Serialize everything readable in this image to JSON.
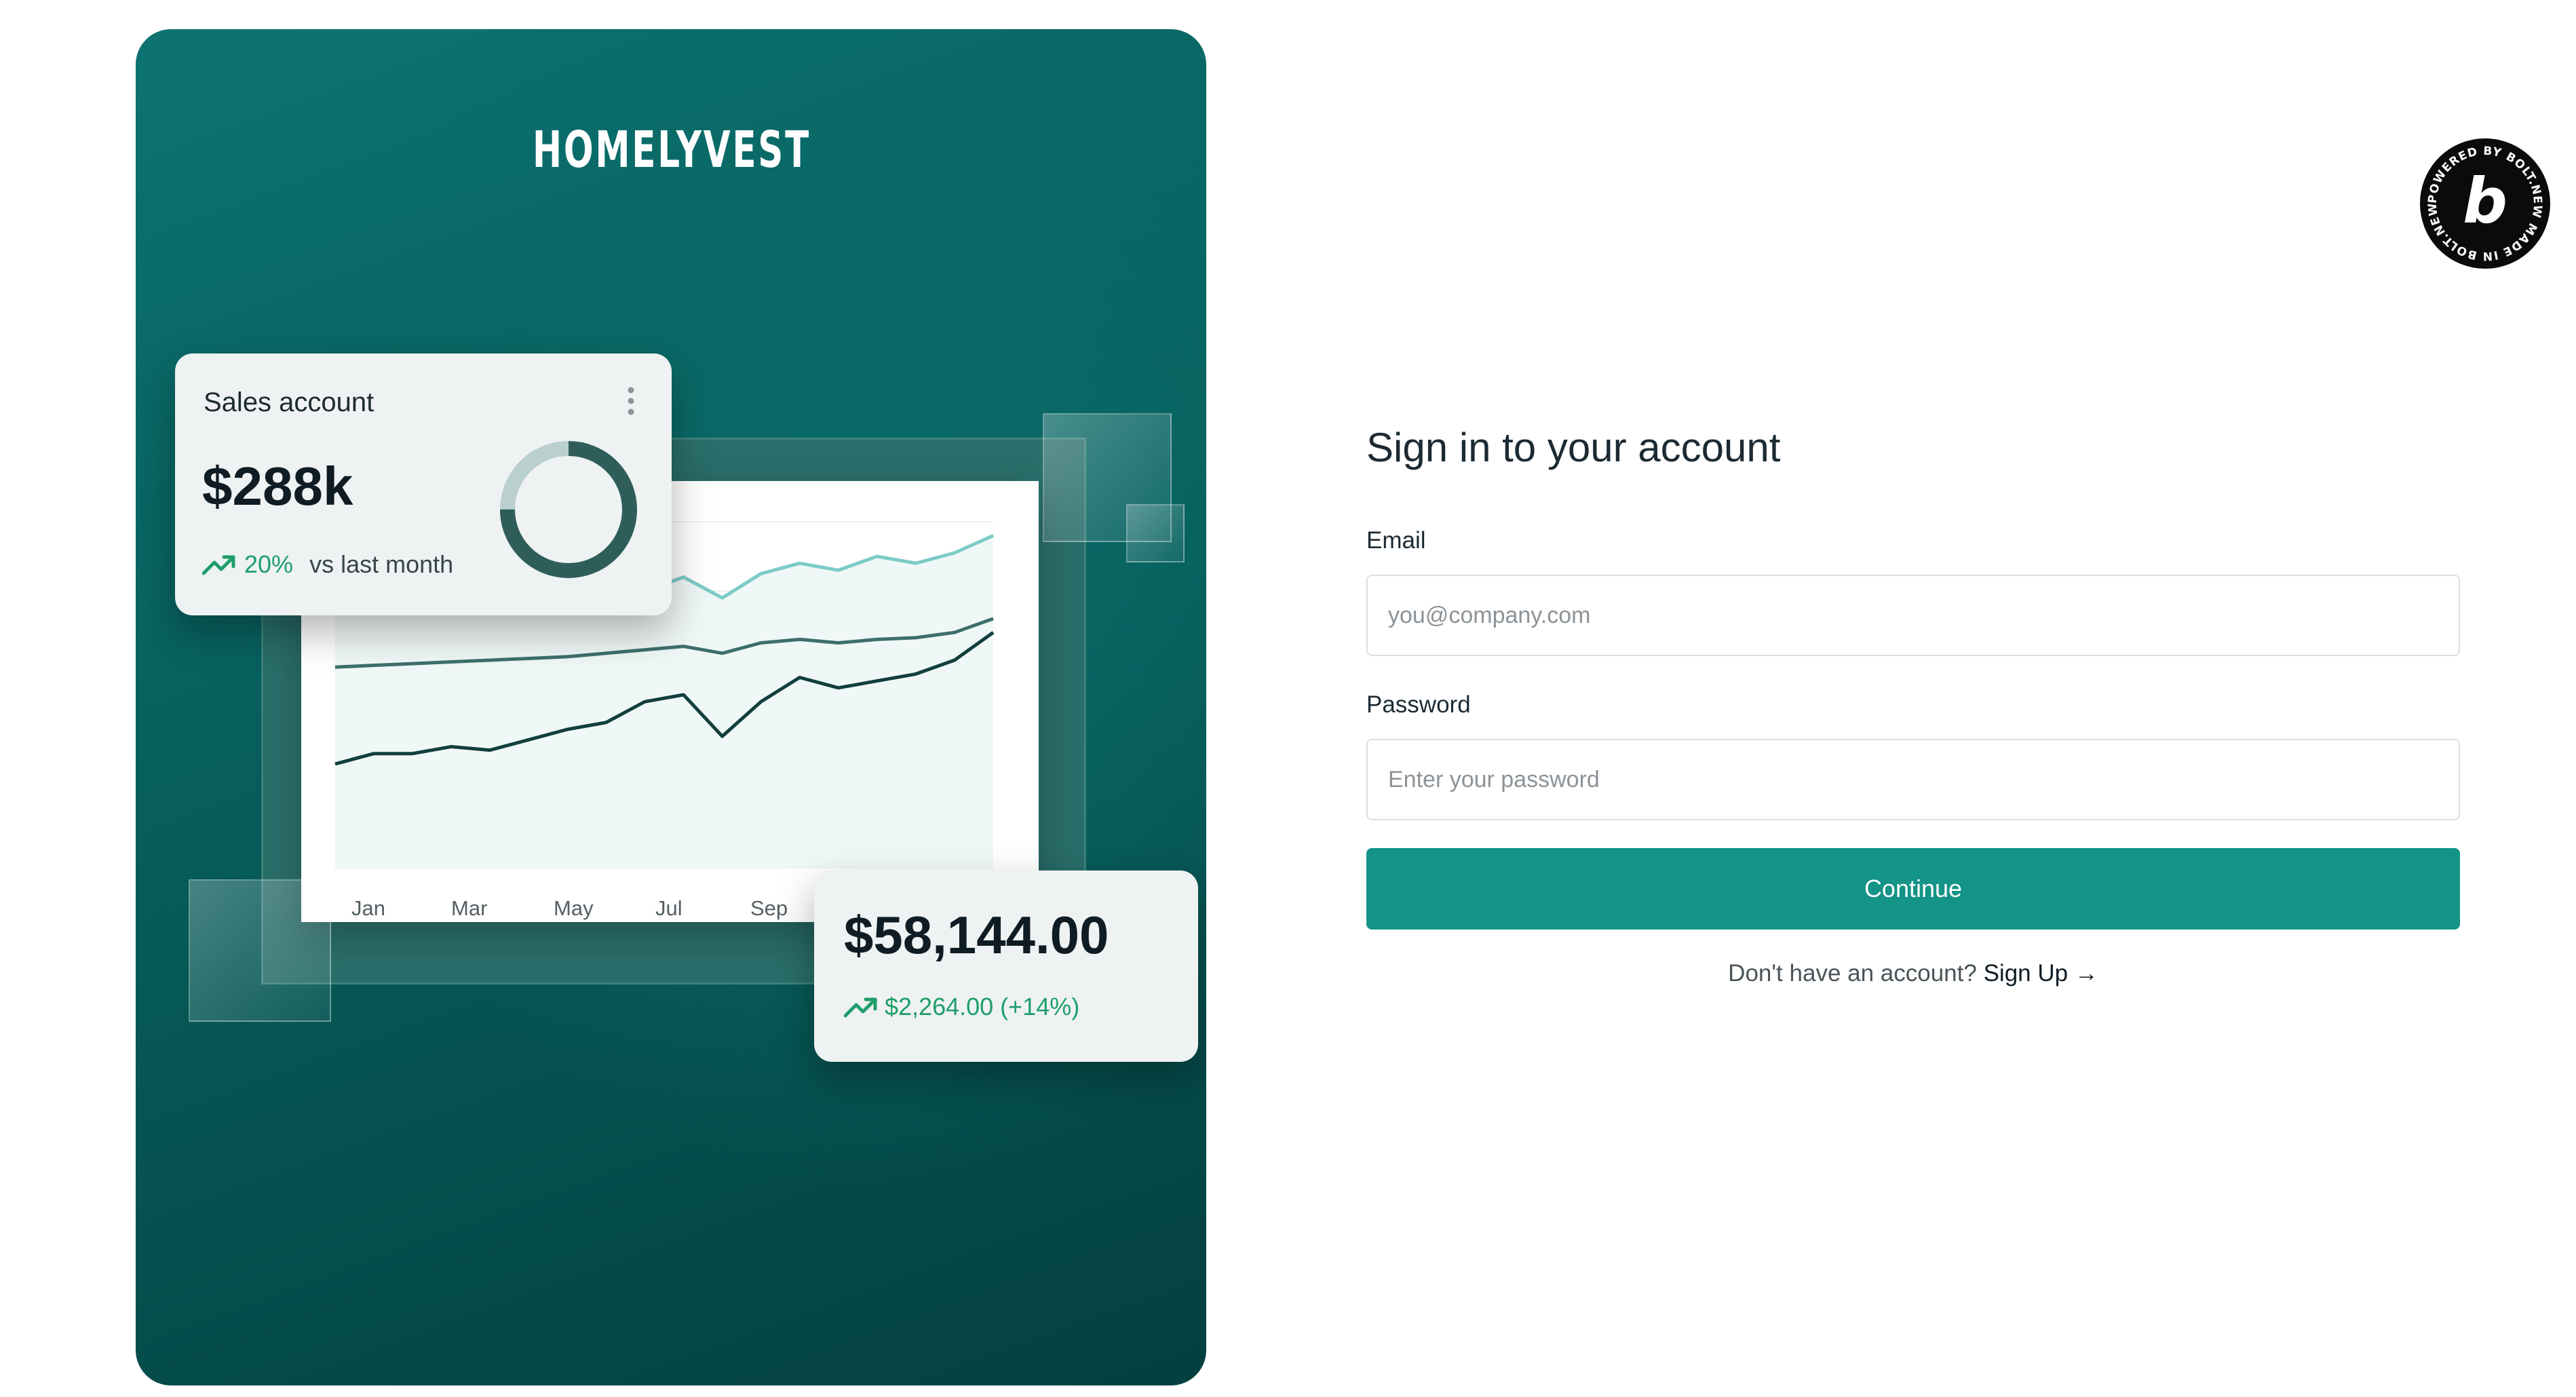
{
  "brand": {
    "logo_text": "HOMELYVEST",
    "colors": {
      "primary": "#139487",
      "hero_dark": "#03403f",
      "hero_light": "#0c7371",
      "positive": "#1e9e6a"
    }
  },
  "hero": {
    "sales_card": {
      "title": "Sales account",
      "value": "$288k",
      "trend_icon": "trend-up-icon",
      "change_percent": "20%",
      "change_label": "vs last month",
      "menu_icon": "more-vertical-icon",
      "donut_fraction": 0.75
    },
    "total_card": {
      "amount": "$58,144.00",
      "trend_icon": "trend-up-icon",
      "change": "$2,264.00 (+14%)"
    },
    "chart_data": {
      "type": "line",
      "categories": [
        "Jan",
        "Mar",
        "May",
        "Jul",
        "Sep"
      ],
      "series": [
        {
          "color": "#7ccbc7",
          "values": [
            74,
            75,
            76,
            77,
            78,
            79,
            80,
            81,
            80,
            84,
            78,
            85,
            88,
            86,
            90,
            88,
            91,
            96
          ]
        },
        {
          "color": "#3d6f6c",
          "values": [
            58,
            58.5,
            59,
            59.5,
            60,
            60.5,
            61,
            62,
            63,
            64,
            62,
            65,
            66,
            65,
            66,
            66.5,
            68,
            72
          ]
        },
        {
          "color": "#123f3e",
          "values": [
            30,
            33,
            33,
            35,
            34,
            37,
            40,
            42,
            48,
            50,
            38,
            48,
            55,
            52,
            54,
            56,
            60,
            68
          ]
        }
      ],
      "ylim": [
        0,
        100
      ]
    }
  },
  "badge": {
    "text": "POWERED BY BOLT.NEW MADE IN BOLT.NEW",
    "letter": "b"
  },
  "form": {
    "heading": "Sign in to your account",
    "email_label": "Email",
    "email_placeholder": "you@company.com",
    "password_label": "Password",
    "password_placeholder": "Enter your password",
    "submit_label": "Continue",
    "signup_prompt": "Don't have an account?",
    "signup_link": "Sign Up →"
  }
}
